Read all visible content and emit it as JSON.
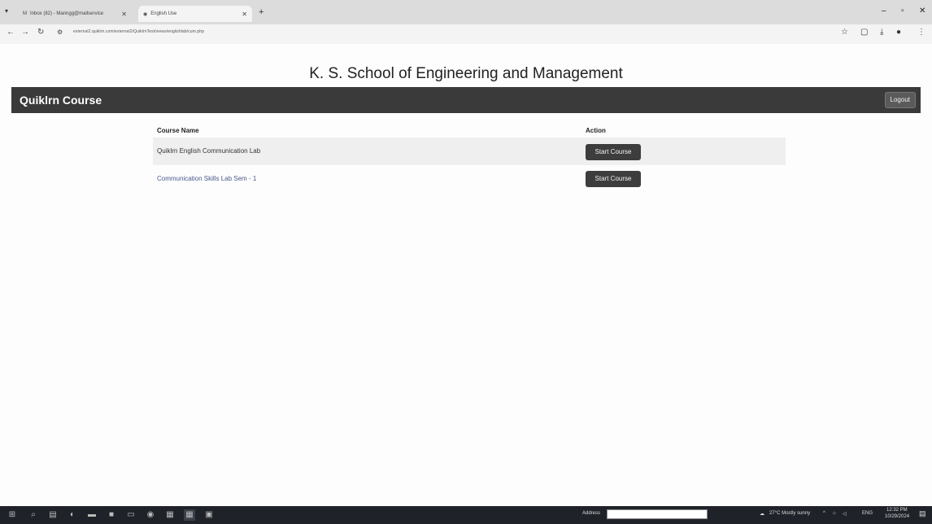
{
  "browser": {
    "tabs": [
      {
        "title": "Inbox (82) - Manngg@mailservice"
      },
      {
        "title": "English Use"
      }
    ],
    "new_tab": "+",
    "url": "external2.quiklrn.com/external2/QuiklrnTest/views/englishlab/cum.php"
  },
  "page": {
    "school_title": "K. S. School of Engineering and Management",
    "brand": "Quiklrn Course",
    "logout_label": "Logout",
    "table": {
      "headers": [
        "Course Name",
        "Action"
      ],
      "rows": [
        {
          "course": "Quiklrn English Communication Lab",
          "action": "Start Course"
        },
        {
          "course": "Communication Skills Lab Sem - 1",
          "action": "Start Course"
        }
      ]
    }
  },
  "taskbar": {
    "address_label": "Address",
    "weather": "27°C Mostly sunny",
    "language": "ENG",
    "time": "12:32 PM",
    "date": "10/29/2024"
  }
}
